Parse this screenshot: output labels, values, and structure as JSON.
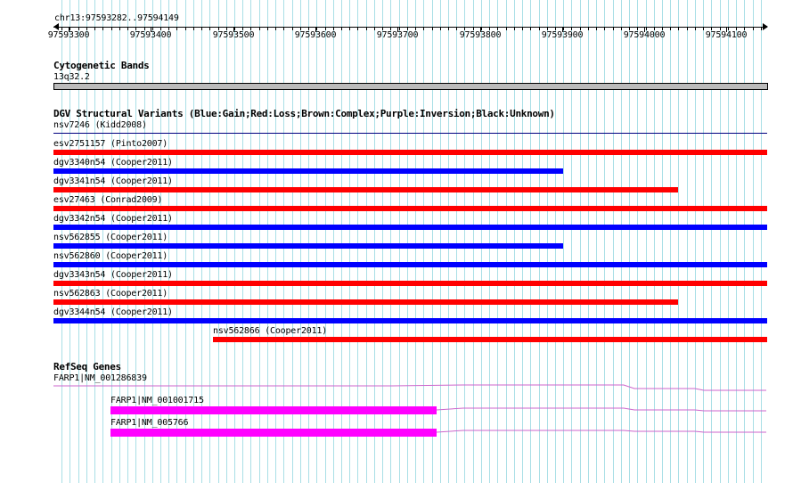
{
  "ruler": {
    "region_label": "chr13:97593282..97594149",
    "ticks": [
      "97593300",
      "97593400",
      "97593500",
      "97593600",
      "97593700",
      "97593800",
      "97593900",
      "97594000",
      "97594100"
    ]
  },
  "cytobands": {
    "title": "Cytogenetic Bands",
    "label": "13q32.2",
    "colors": {
      "fill": "#bbbbbb",
      "stroke": "#000000"
    }
  },
  "dgv": {
    "title": "DGV Structural Variants (Blue:Gain;Red:Loss;Brown:Complex;Purple:Inversion;Black:Unknown)",
    "colors": {
      "gain": "#0000ff",
      "loss": "#ff0000",
      "unknown": "#000080"
    },
    "features": [
      {
        "label": "nsv7246 (Kidd2008)",
        "type": "unknown"
      },
      {
        "label": "esv2751157 (Pinto2007)",
        "type": "loss"
      },
      {
        "label": "dgv3340n54 (Cooper2011)",
        "type": "gain"
      },
      {
        "label": "dgv3341n54 (Cooper2011)",
        "type": "loss"
      },
      {
        "label": "esv27463 (Conrad2009)",
        "type": "loss"
      },
      {
        "label": "dgv3342n54 (Cooper2011)",
        "type": "gain"
      },
      {
        "label": "nsv562855 (Cooper2011)",
        "type": "gain"
      },
      {
        "label": "nsv562860 (Cooper2011)",
        "type": "gain"
      },
      {
        "label": "dgv3343n54 (Cooper2011)",
        "type": "loss"
      },
      {
        "label": "nsv562863 (Cooper2011)",
        "type": "loss"
      },
      {
        "label": "dgv3344n54 (Cooper2011)",
        "type": "gain"
      },
      {
        "label": "nsv562866 (Cooper2011)",
        "type": "loss"
      }
    ]
  },
  "refseq": {
    "title": "RefSeq Genes",
    "colors": {
      "exon": "#ff00ff",
      "intron": "#cc66cc"
    },
    "genes": [
      {
        "label": "FARP1|NM_001286839"
      },
      {
        "label": "FARP1|NM_001001715"
      },
      {
        "label": "FARP1|NM_005766"
      }
    ]
  }
}
